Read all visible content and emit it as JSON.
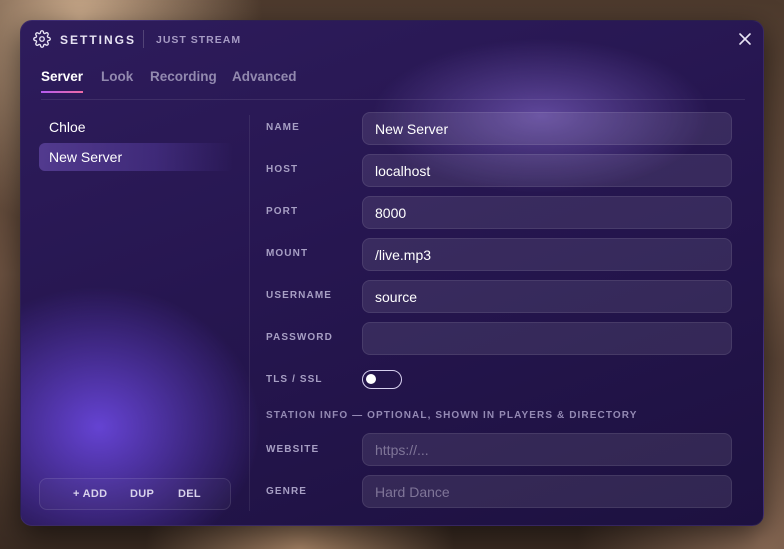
{
  "window": {
    "title": "SETTINGS",
    "subtitle": "JUST STREAM",
    "icons": {
      "settings": "gear-icon",
      "close": "close-icon"
    }
  },
  "tabs": [
    {
      "label": "Server",
      "active": true
    },
    {
      "label": "Look",
      "active": false
    },
    {
      "label": "Recording",
      "active": false
    },
    {
      "label": "Advanced",
      "active": false
    }
  ],
  "servers": [
    {
      "name": "Chloe",
      "selected": false
    },
    {
      "name": "New Server",
      "selected": true
    }
  ],
  "server_actions": {
    "add": "+ ADD",
    "dup": "DUP",
    "del": "DEL"
  },
  "form": {
    "name": {
      "label": "NAME",
      "value": "New Server"
    },
    "host": {
      "label": "HOST",
      "value": "localhost"
    },
    "port": {
      "label": "PORT",
      "value": "8000"
    },
    "mount": {
      "label": "MOUNT",
      "value": "/live.mp3"
    },
    "username": {
      "label": "USERNAME",
      "value": "source"
    },
    "password": {
      "label": "PASSWORD",
      "value": ""
    },
    "tls": {
      "label": "TLS / SSL",
      "enabled": false
    },
    "station_info_label": "STATION INFO — OPTIONAL, SHOWN IN PLAYERS & DIRECTORY",
    "website": {
      "label": "WEBSITE",
      "value": "",
      "placeholder": "https://..."
    },
    "genre": {
      "label": "GENRE",
      "value": "",
      "placeholder": "Hard Dance"
    }
  },
  "colors": {
    "accent_gradient_start": "#b45cf0",
    "accent_gradient_end": "#ef6aa5",
    "panel": "#261650"
  }
}
